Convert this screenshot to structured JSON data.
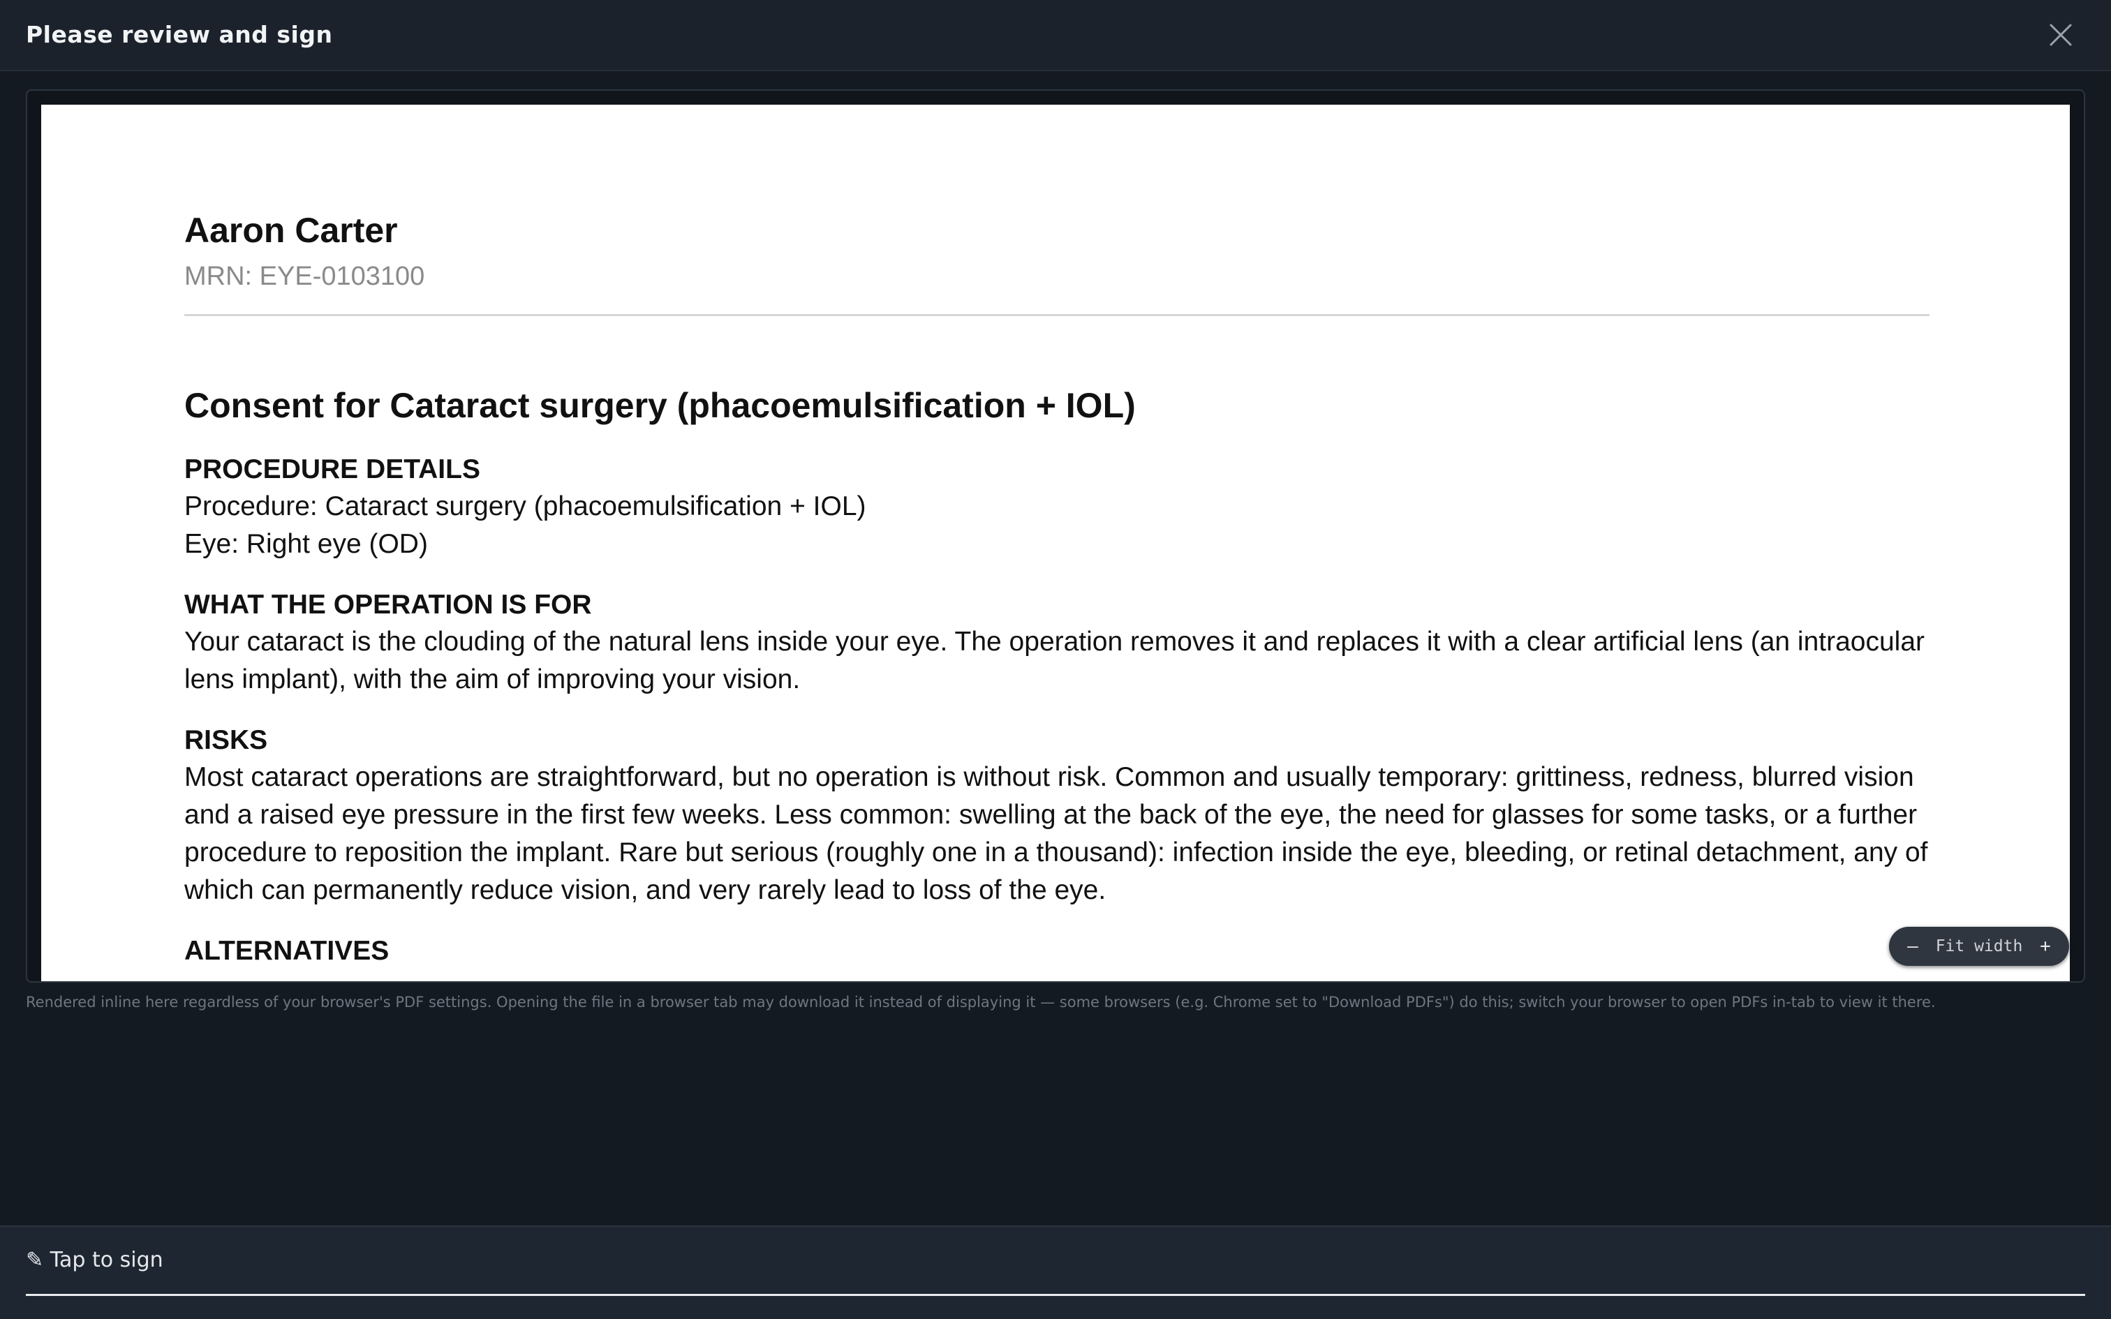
{
  "header": {
    "title": "Please review and sign",
    "close_icon": "close-icon"
  },
  "document": {
    "patient_name": "Aaron Carter",
    "mrn": "MRN: EYE-0103100",
    "consent_title": "Consent for Cataract surgery (phacoemulsification + IOL)",
    "sections": {
      "procedure_details": {
        "heading": "PROCEDURE DETAILS",
        "procedure": "Procedure: Cataract surgery (phacoemulsification + IOL)",
        "eye": "Eye: Right eye (OD)"
      },
      "purpose": {
        "heading": "WHAT THE OPERATION IS FOR",
        "text": "Your cataract is the clouding of the natural lens inside your eye. The operation removes it and replaces it with a clear artificial lens (an intraocular lens implant), with the aim of improving your vision."
      },
      "risks": {
        "heading": "RISKS",
        "text": "Most cataract operations are straightforward, but no operation is without risk. Common and usually temporary: grittiness, redness, blurred vision and a raised eye pressure in the first few weeks. Less common: swelling at the back of the eye, the need for glasses for some tasks, or a further procedure to reposition the implant. Rare but serious (roughly one in a thousand): infection inside the eye, bleeding, or retinal detachment, any of which can permanently reduce vision, and very rarely lead to loss of the eye."
      },
      "alternatives": {
        "heading": "ALTERNATIVES"
      }
    }
  },
  "zoom": {
    "minus": "–",
    "label": "Fit width",
    "plus": "+"
  },
  "note": "Rendered inline here regardless of your browser's PDF settings. Opening the file in a browser tab may download it instead of displaying it — some browsers (e.g. Chrome set to \"Download PDFs\") do this; switch your browser to open PDFs in-tab to view it there.",
  "sign": {
    "label": "✎ Tap to sign"
  }
}
